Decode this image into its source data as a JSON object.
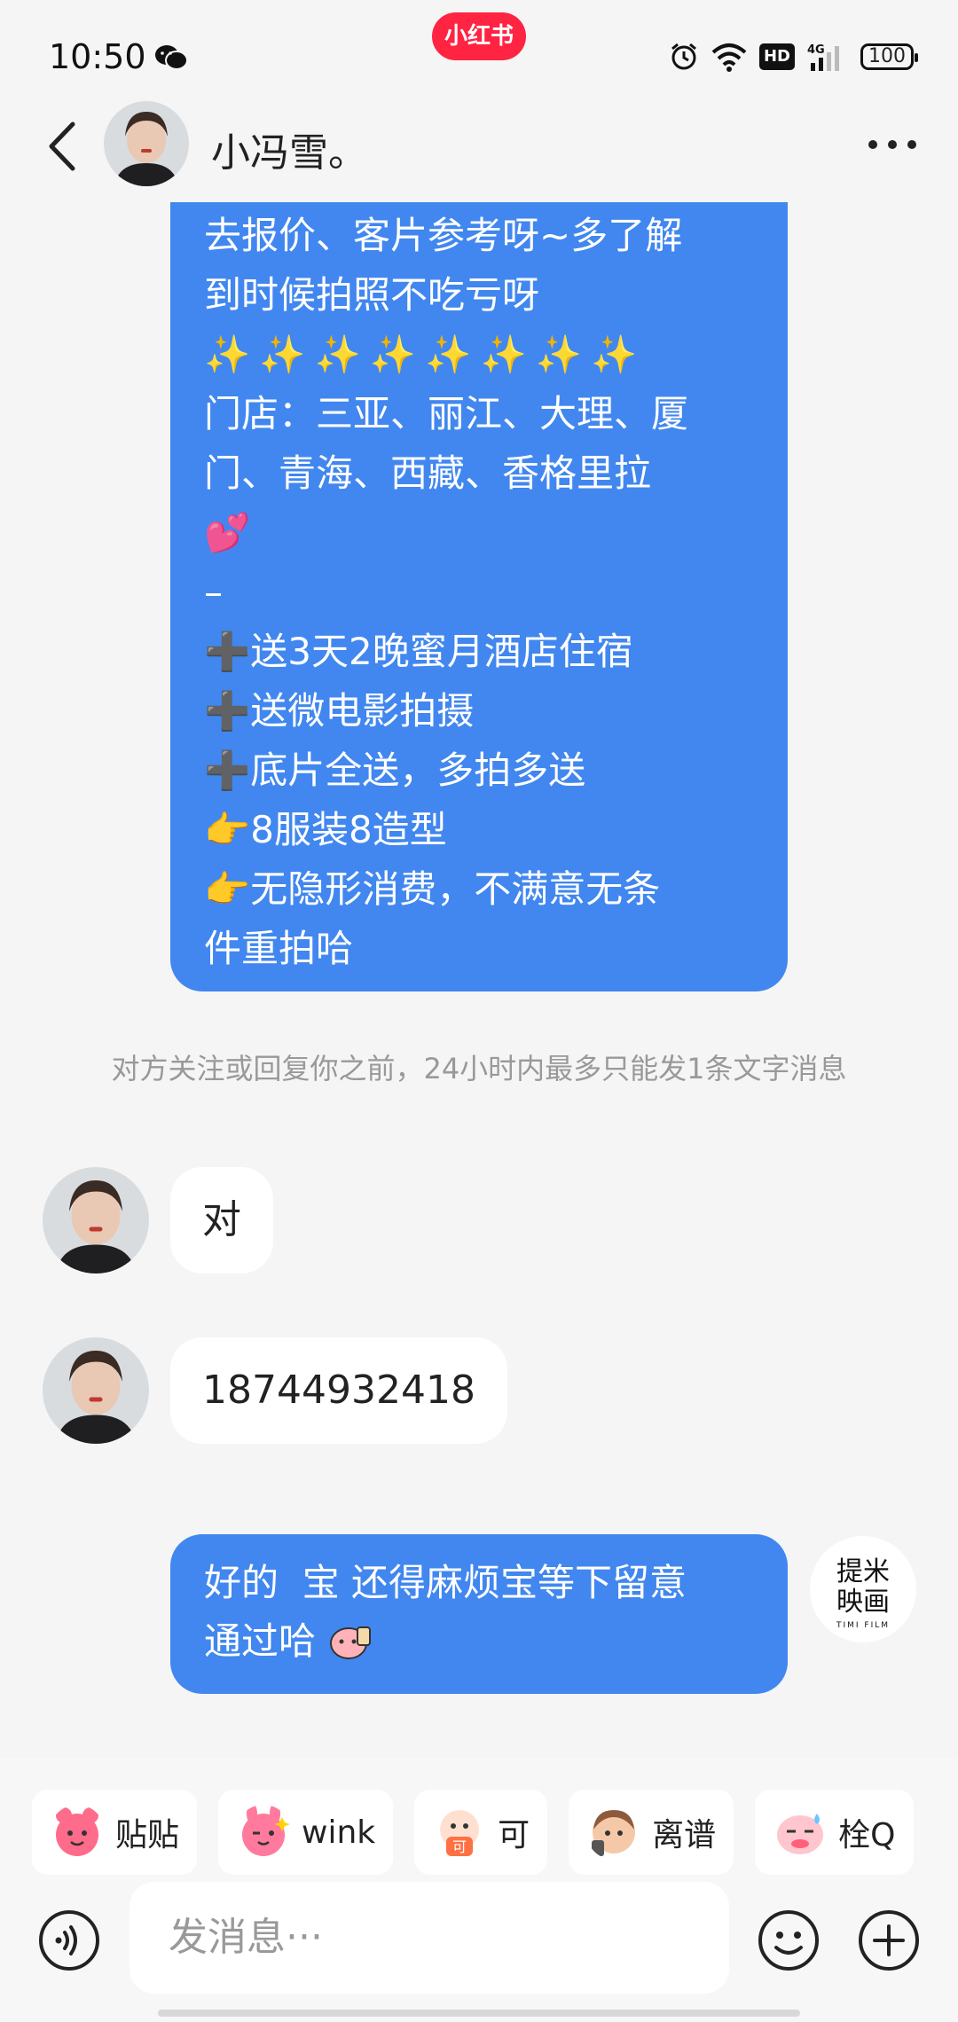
{
  "status_bar": {
    "time": "10:50",
    "app_badge": "小红书",
    "hd": "HD",
    "network": "4G",
    "battery": "100"
  },
  "header": {
    "name": "小冯雪。"
  },
  "messages": {
    "long_bubble": {
      "lines": [
        "去报价、客片参考呀~多了解",
        "到时候拍照不吃亏呀",
        "✨✨✨✨✨✨✨✨",
        "门店：三亚、丽江、大理、厦",
        "门、青海、西藏、香格里拉",
        "💕",
        "–"
      ],
      "plus_items": [
        "送3天2晚蜜月酒店住宿",
        "送微电影拍摄",
        "底片全送，多拍多送"
      ],
      "point_items": [
        "8服装8造型",
        "无隐形消费，不满意无条"
      ],
      "last_line": "件重拍哈"
    },
    "notice": "对方关注或回复你之前，24小时内最多只能发1条文字消息",
    "incoming_1": "对",
    "incoming_2": "18744932418",
    "outgoing": {
      "line1": "好的  宝 还得麻烦宝等下留意",
      "line2": "通过哈"
    },
    "self_avatar": {
      "line1a": "提米",
      "line1b": "映画",
      "line2": "TIMI FILM"
    }
  },
  "stickers": [
    {
      "label": "贴贴",
      "color": "#ff6b8a"
    },
    {
      "label": "wink",
      "color": "#ff7a9c"
    },
    {
      "label": "可",
      "color": "#ff8a5c"
    },
    {
      "label": "离谱",
      "color": "#f0b27a"
    },
    {
      "label": "栓Q",
      "color": "#ff9eb0"
    }
  ],
  "input": {
    "placeholder": "发消息···"
  },
  "colors": {
    "bubble_blue": "#4187ef",
    "brand_red": "#ff2442"
  }
}
